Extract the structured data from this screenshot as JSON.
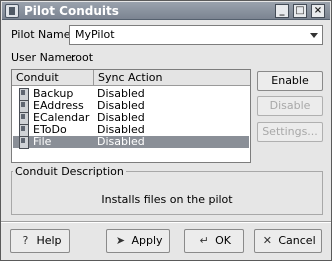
{
  "window": {
    "title": "Pilot Conduits",
    "minimize_glyph": "_",
    "maximize_glyph": "□",
    "close_glyph": "×"
  },
  "pilot": {
    "name_label": "Pilot Name:",
    "name_value": "MyPilot",
    "user_label": "User Name:",
    "user_value": "root"
  },
  "conduits": {
    "columns": [
      "Conduit",
      "Sync Action"
    ],
    "rows": [
      {
        "name": "Backup",
        "sync": "Disabled",
        "icon": "pilot-device-icon",
        "selected": false
      },
      {
        "name": "EAddress",
        "sync": "Disabled",
        "icon": "pilot-device-icon",
        "selected": false
      },
      {
        "name": "ECalendar",
        "sync": "Disabled",
        "icon": "pilot-device-icon",
        "selected": false
      },
      {
        "name": "EToDo",
        "sync": "Disabled",
        "icon": "pilot-device-icon",
        "selected": false
      },
      {
        "name": "File",
        "sync": "Disabled",
        "icon": "pilot-device-icon",
        "selected": true
      }
    ]
  },
  "actions": {
    "enable": "Enable",
    "disable": "Disable",
    "settings": "Settings..."
  },
  "description": {
    "title": "Conduit Description",
    "text": "Installs files on the pilot"
  },
  "buttons": {
    "help": "Help",
    "apply": "Apply",
    "ok": "OK",
    "cancel": "Cancel"
  },
  "colors": {
    "selection": "#8a8f97",
    "titlebar": "#7b8491",
    "disabled_text": "#a8a8a8"
  }
}
